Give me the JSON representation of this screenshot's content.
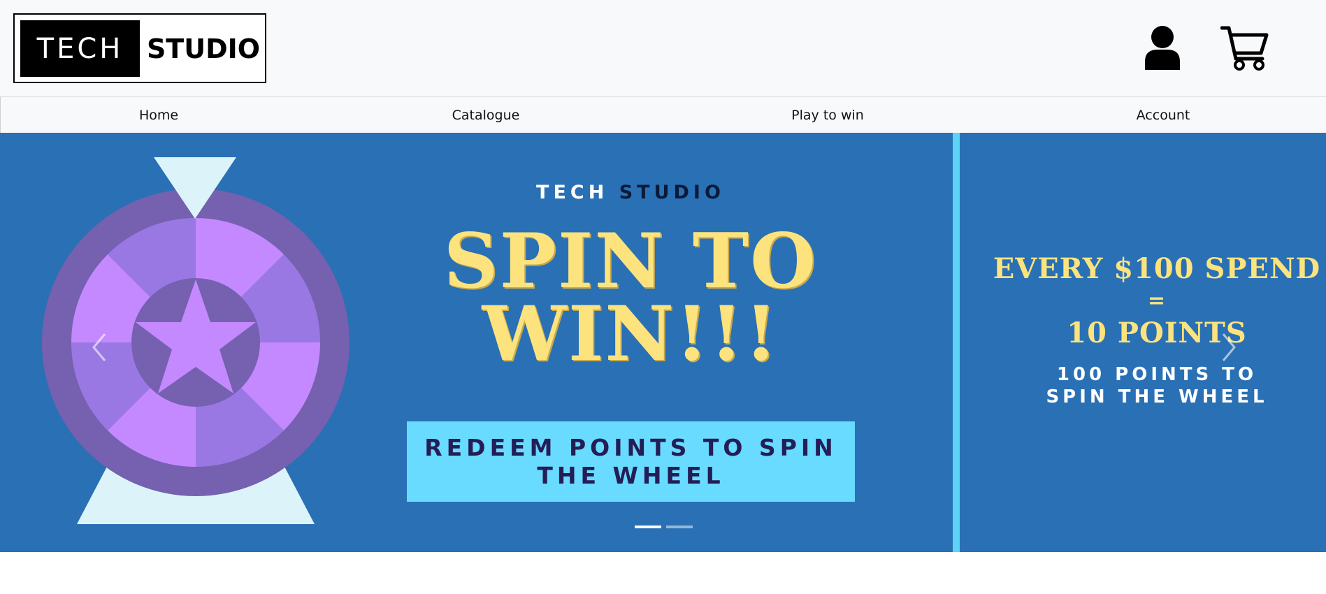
{
  "header": {
    "logo_left": "TECH",
    "logo_right": "STUDIO",
    "user_icon": "user-icon",
    "cart_icon": "cart-icon"
  },
  "nav": {
    "items": [
      {
        "label": "Home"
      },
      {
        "label": "Catalogue"
      },
      {
        "label": "Play to win"
      },
      {
        "label": "Account"
      }
    ]
  },
  "carousel": {
    "brand_part1": "TECH",
    "brand_part2": "STUDIO",
    "headline_line1": "SPIN TO",
    "headline_line2": "WIN!!!",
    "redeem_line1": "REDEEM POINTS TO SPIN",
    "redeem_line2": "THE WHEEL",
    "rule_line1": "EVERY $100 SPEND",
    "rule_line2": "=",
    "rule_line3": "10 POINTS",
    "sub_line1": "100 POINTS TO",
    "sub_line2": "SPIN THE WHEEL",
    "prev_icon": "chevron-left-icon",
    "next_icon": "chevron-right-icon",
    "slide_count": 2,
    "active_slide": 1
  },
  "colors": {
    "hero_bg": "#2a70b5",
    "accent_cyan": "#68dbff",
    "headline_yellow": "#fce37e",
    "wheel_purple_dark": "#7660b0",
    "wheel_purple_light": "#c489ff",
    "wheel_purple_mid": "#9a78e3"
  }
}
